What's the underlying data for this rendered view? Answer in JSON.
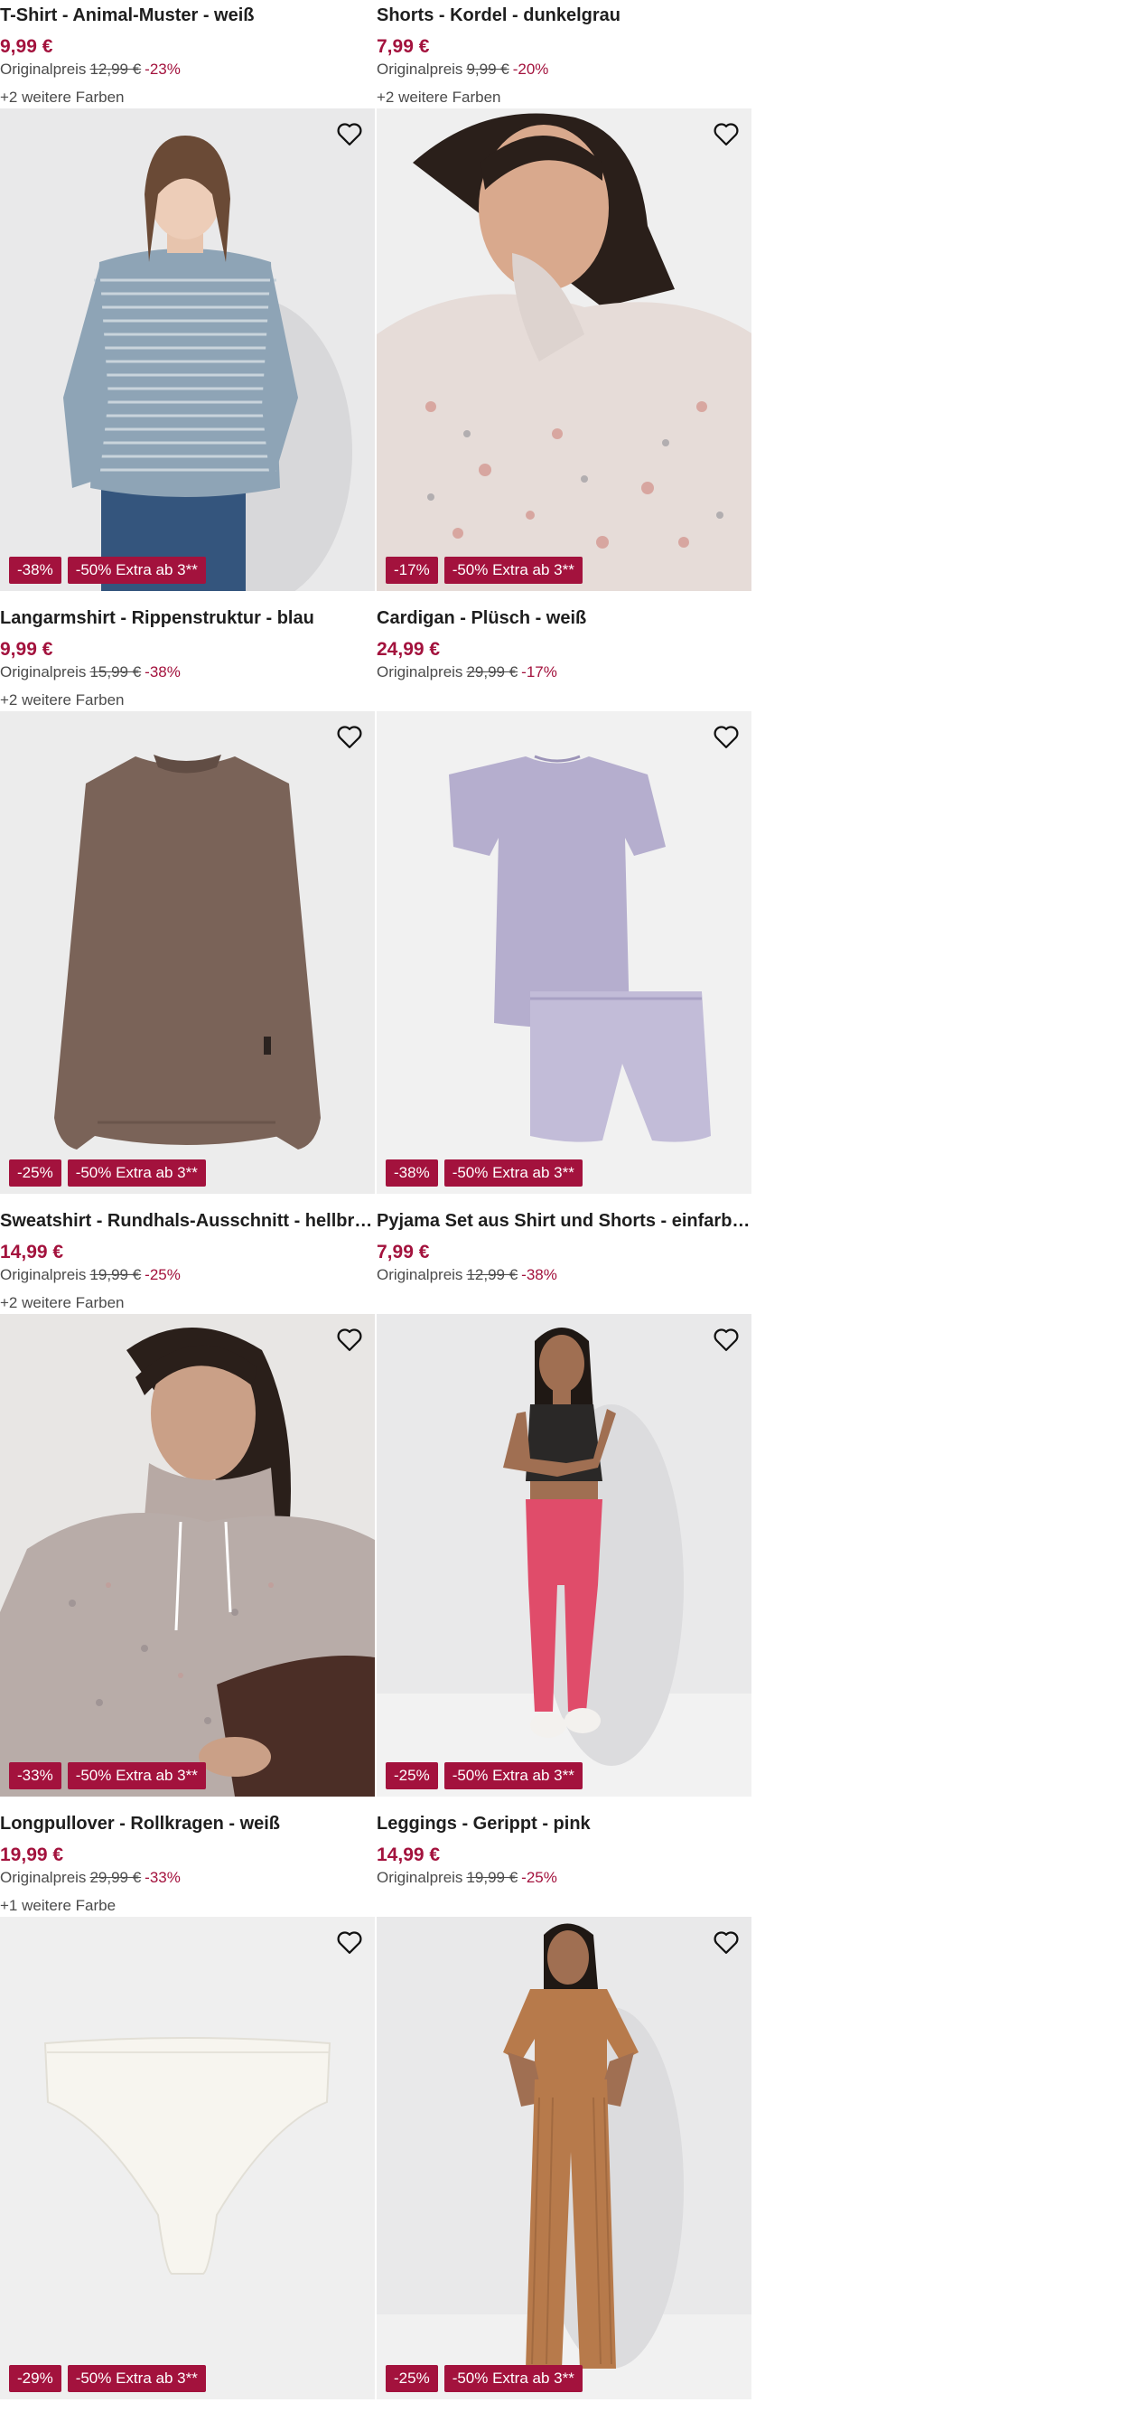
{
  "colors": {
    "accent": "#a3123d"
  },
  "top_row": [
    {
      "title": "T-Shirt - Animal-Muster - weiß",
      "price": "9,99 €",
      "orig_label": "Originalpreis",
      "orig_price": "12,99 €",
      "discount": "-23%",
      "more_colors": "+2 weitere Farben"
    },
    {
      "title": "Shorts - Kordel - dunkelgrau",
      "price": "7,99 €",
      "orig_label": "Originalpreis",
      "orig_price": "9,99 €",
      "discount": "-20%",
      "more_colors": "+2 weitere Farben"
    }
  ],
  "products": [
    {
      "title": "Langarmshirt - Rippenstruktur - blau",
      "price": "9,99 €",
      "orig_label": "Originalpreis",
      "orig_price": "15,99 €",
      "discount": "-38%",
      "more_colors": "+2 weitere Farben",
      "badge_discount": "-38%",
      "badge_extra": "-50% Extra ab 3**",
      "image": "woman-striped-longsleeve"
    },
    {
      "title": "Cardigan - Plüsch - weiß",
      "price": "24,99 €",
      "orig_label": "Originalpreis",
      "orig_price": "29,99 €",
      "discount": "-17%",
      "more_colors": "",
      "badge_discount": "-17%",
      "badge_extra": "-50% Extra ab 3**",
      "image": "woman-fluffy-cardigan"
    },
    {
      "title": "Sweatshirt - Rundhals-Ausschnitt - hellbraun",
      "price": "14,99 €",
      "orig_label": "Originalpreis",
      "orig_price": "19,99 €",
      "discount": "-25%",
      "more_colors": "+2 weitere Farben",
      "badge_discount": "-25%",
      "badge_extra": "-50% Extra ab 3**",
      "image": "brown-sweatshirt"
    },
    {
      "title": "Pyjama Set aus Shirt und Shorts - einfarbig -...",
      "price": "7,99 €",
      "orig_label": "Originalpreis",
      "orig_price": "12,99 €",
      "discount": "-38%",
      "more_colors": "",
      "badge_discount": "-38%",
      "badge_extra": "-50% Extra ab 3**",
      "image": "lilac-pyjama-set"
    },
    {
      "title": "Longpullover - Rollkragen - weiß",
      "price": "19,99 €",
      "orig_label": "Originalpreis",
      "orig_price": "29,99 €",
      "discount": "-33%",
      "more_colors": "+1 weitere Farbe",
      "badge_discount": "-33%",
      "badge_extra": "-50% Extra ab 3**",
      "image": "woman-turtleneck-pullover"
    },
    {
      "title": "Leggings - Gerippt - pink",
      "price": "14,99 €",
      "orig_label": "Originalpreis",
      "orig_price": "19,99 €",
      "discount": "-25%",
      "more_colors": "",
      "badge_discount": "-25%",
      "badge_extra": "-50% Extra ab 3**",
      "image": "woman-pink-leggings"
    },
    {
      "title": "",
      "price": "",
      "orig_label": "",
      "orig_price": "",
      "discount": "",
      "more_colors": "",
      "badge_discount": "-29%",
      "badge_extra": "-50% Extra ab 3**",
      "image": "white-brief"
    },
    {
      "title": "",
      "price": "",
      "orig_label": "",
      "orig_price": "",
      "discount": "",
      "more_colors": "",
      "badge_discount": "-25%",
      "badge_extra": "-50% Extra ab 3**",
      "image": "woman-brown-set"
    }
  ]
}
